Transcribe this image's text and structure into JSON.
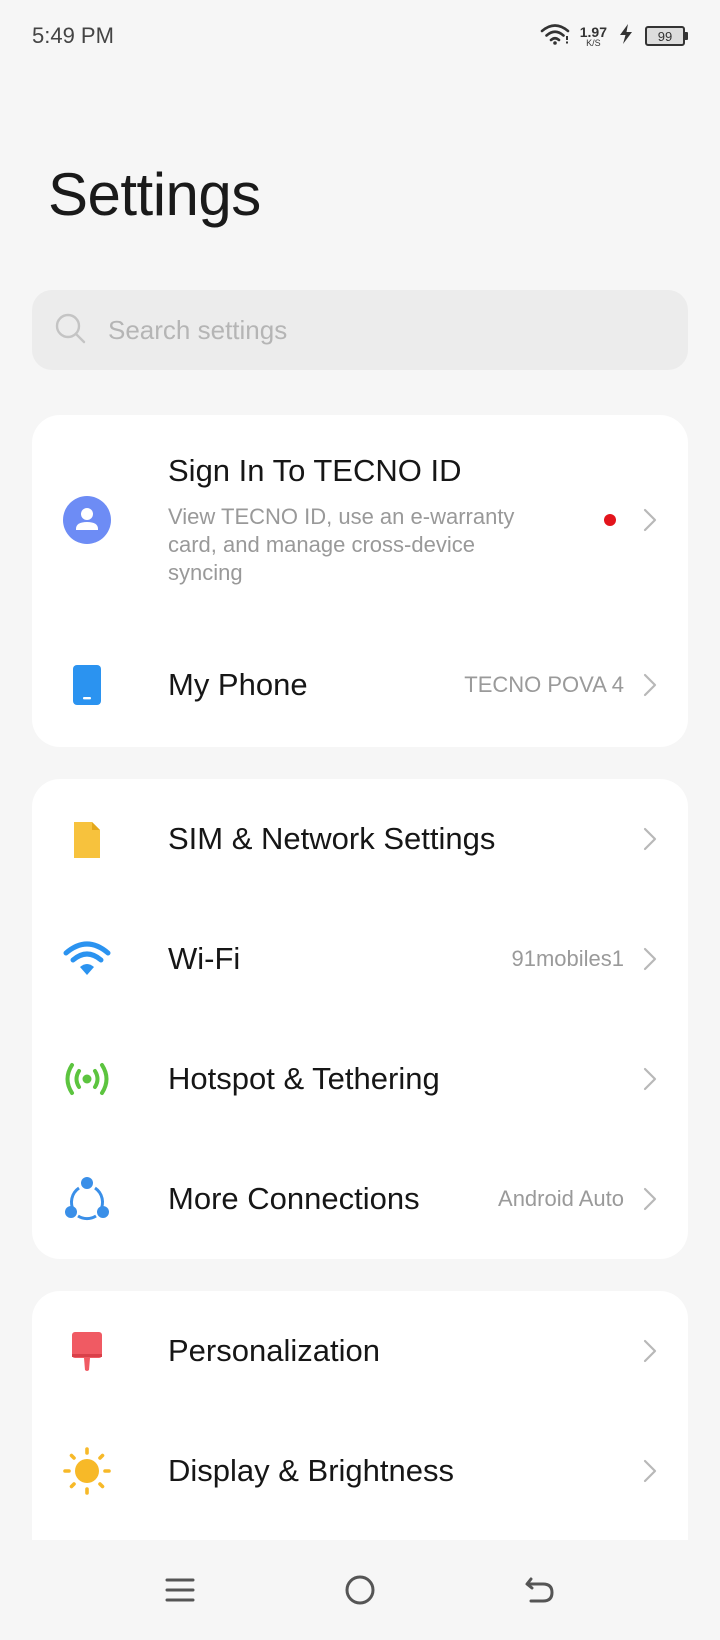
{
  "status_bar": {
    "time": "5:49 PM",
    "net_speed_value": "1.97",
    "net_speed_unit": "K/S",
    "battery_level": "99"
  },
  "page": {
    "title": "Settings"
  },
  "search": {
    "placeholder": "Search settings",
    "value": ""
  },
  "account_card": {
    "sign_in": {
      "title": "Sign In To TECNO ID",
      "description": "View TECNO ID, use an e-warranty card, and manage cross-device syncing",
      "icon": "account-icon",
      "has_notification_dot": true
    },
    "my_phone": {
      "label": "My Phone",
      "value": "TECNO POVA 4",
      "icon": "phone-icon"
    }
  },
  "connections_card": {
    "items": [
      {
        "label": "SIM & Network Settings",
        "value": "",
        "icon": "sim-card-icon"
      },
      {
        "label": "Wi-Fi",
        "value": "91mobiles1",
        "icon": "wifi-icon"
      },
      {
        "label": "Hotspot & Tethering",
        "value": "",
        "icon": "hotspot-icon"
      },
      {
        "label": "More Connections",
        "value": "Android Auto",
        "icon": "more-connections-icon"
      }
    ]
  },
  "device_card": {
    "items": [
      {
        "label": "Personalization",
        "value": "",
        "icon": "brush-icon"
      },
      {
        "label": "Display & Brightness",
        "value": "",
        "icon": "brightness-icon"
      }
    ]
  },
  "colors": {
    "background": "#f6f6f6",
    "card": "#ffffff",
    "account_blue": "#6d8cf5",
    "phone_blue": "#2b93f0",
    "sim_yellow": "#f7c23d",
    "wifi_blue": "#2b93f0",
    "hotspot_green": "#5cc43f",
    "connections_blue": "#3a8fe8",
    "brush_red": "#f05a63",
    "sun_yellow": "#f7b928",
    "notification_red": "#e3141c"
  },
  "nav_bar": {
    "icons": [
      "menu-icon",
      "home-icon",
      "back-icon"
    ]
  }
}
